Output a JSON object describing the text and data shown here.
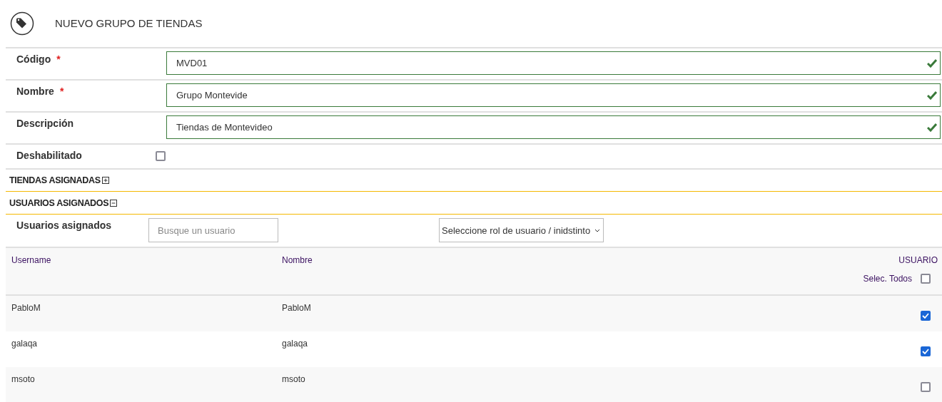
{
  "header": {
    "title": "NUEVO GRUPO DE TIENDAS"
  },
  "fields": [
    {
      "label": "Código",
      "required_mark": "*",
      "value": "MVD01",
      "valid": true
    },
    {
      "label": "Nombre",
      "required_mark": "*",
      "value": "Grupo Montevide",
      "valid": true
    },
    {
      "label": "Descripción",
      "value": "Tiendas de Montevideo",
      "valid": true
    }
  ],
  "disabled": {
    "label": "Deshabilitado",
    "checked": false
  },
  "sections": [
    {
      "title": "TIENDAS ASIGNADAS",
      "expanded": false
    },
    {
      "title": "USUARIOS ASIGNADOS",
      "expanded": true
    }
  ],
  "users_filter": {
    "label": "Usuarios asignados",
    "search": {
      "placeholder": "Busque un usuario"
    },
    "role_select": {
      "value": "Seleccione rol de usuario / inidstinto"
    }
  },
  "table": {
    "columns": [
      "Username",
      "Nombre"
    ],
    "check_column": {
      "title": "USUARIO",
      "select_all_label": "Selec. Todos",
      "select_all_checked": false
    },
    "rows": [
      {
        "username": "PabloM",
        "nombre": "PabloM",
        "checked": true
      },
      {
        "username": "galaqa",
        "nombre": "galaqa",
        "checked": true
      },
      {
        "username": "msoto",
        "nombre": "msoto",
        "checked": false
      }
    ]
  }
}
